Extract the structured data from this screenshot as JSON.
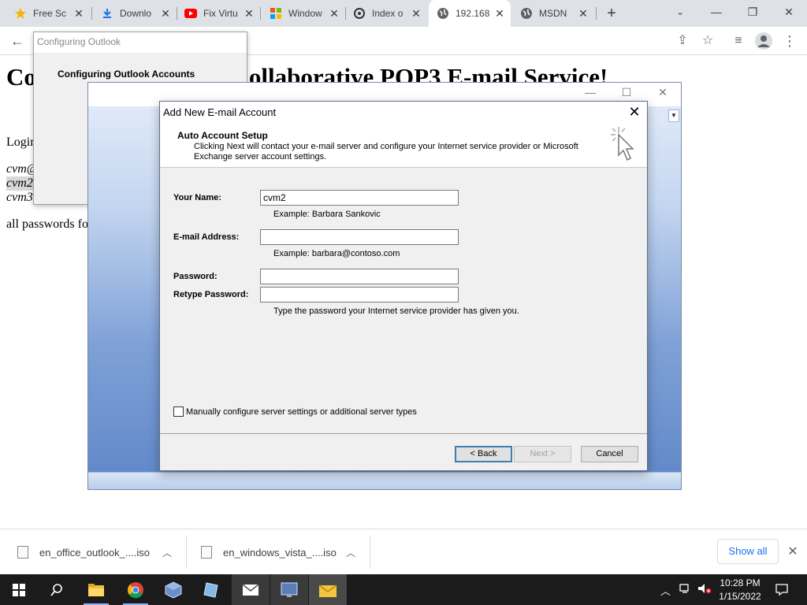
{
  "browser": {
    "tabs": [
      {
        "title": "Free Sc",
        "icon": "star-icon"
      },
      {
        "title": "Downlo",
        "icon": "download-icon"
      },
      {
        "title": "Fix Virtu",
        "icon": "youtube-icon"
      },
      {
        "title": "Window",
        "icon": "windows-icon"
      },
      {
        "title": "Index o",
        "icon": "index-icon"
      },
      {
        "title": "192.168",
        "icon": "globe-icon"
      },
      {
        "title": "MSDN",
        "icon": "globe-icon"
      }
    ],
    "active_tab_index": 5
  },
  "page": {
    "heading_left": "Co",
    "heading_right": "ollaborative POP3 E-mail Service!",
    "line_login": "Login",
    "line_cvm1": "cvm@",
    "line_cvm2": "cvm2",
    "line_cvm3": "cvm3",
    "line_passwords": "all passwords fo"
  },
  "configuring_window": {
    "title": "Configuring Outlook",
    "body": "Configuring Outlook Accounts"
  },
  "dialog": {
    "title": "Add New E-mail Account",
    "section_title": "Auto Account Setup",
    "section_desc": "Clicking Next will contact your e-mail server and configure your Internet service provider or Microsoft Exchange server account settings.",
    "fields": {
      "name_label": "Your Name:",
      "name_value": "cvm2",
      "name_hint": "Example: Barbara Sankovic",
      "email_label": "E-mail Address:",
      "email_value": "",
      "email_hint": "Example: barbara@contoso.com",
      "password_label": "Password:",
      "password_value": "",
      "retype_label": "Retype Password:",
      "retype_value": "",
      "password_hint": "Type the password your Internet service provider has given you."
    },
    "manual_checkbox_label": "Manually configure server settings or additional server types",
    "manual_checked": false,
    "back_label": "< Back",
    "next_label": "Next >",
    "cancel_label": "Cancel"
  },
  "downloads": {
    "items": [
      {
        "name": "en_office_outlook_....iso"
      },
      {
        "name": "en_windows_vista_....iso"
      }
    ],
    "show_all_label": "Show all"
  },
  "taskbar": {
    "time": "10:28 PM",
    "date": "1/15/2022"
  },
  "colors": {
    "accent": "#1a73e8",
    "default_button_border": "#3c7fb1",
    "taskbar": "#1b1b1b"
  }
}
